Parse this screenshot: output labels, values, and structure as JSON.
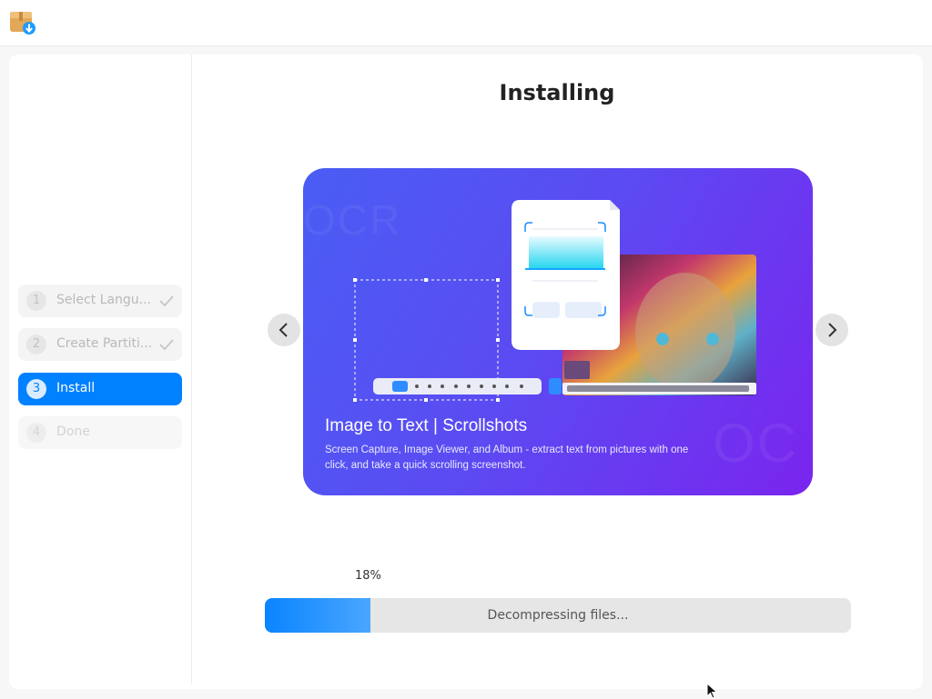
{
  "titlebar": {
    "app_icon": "installer-package-icon"
  },
  "sidebar": {
    "steps": [
      {
        "number": "1",
        "label": "Select Langu...",
        "state": "completed",
        "icon": "check-icon"
      },
      {
        "number": "2",
        "label": "Create Partiti...",
        "state": "completed",
        "icon": "check-icon"
      },
      {
        "number": "3",
        "label": "Install",
        "state": "active"
      },
      {
        "number": "4",
        "label": "Done",
        "state": "pending"
      }
    ]
  },
  "main": {
    "title": "Installing",
    "carousel": {
      "prev_icon": "chevron-left-icon",
      "next_icon": "chevron-right-icon",
      "slide": {
        "title": "Image to Text | Scrollshots",
        "description": "Screen Capture, Image Viewer, and Album - extract text from pictures with one click, and take a quick scrolling screenshot."
      }
    },
    "progress": {
      "percent_label": "18%",
      "value": 0.18,
      "status": "Decompressing files..."
    }
  },
  "colors": {
    "accent": "#0081ff",
    "slide_gradient_start": "#4a5df4",
    "slide_gradient_end": "#7a25ee",
    "progress_fill": "#0a84ff"
  }
}
